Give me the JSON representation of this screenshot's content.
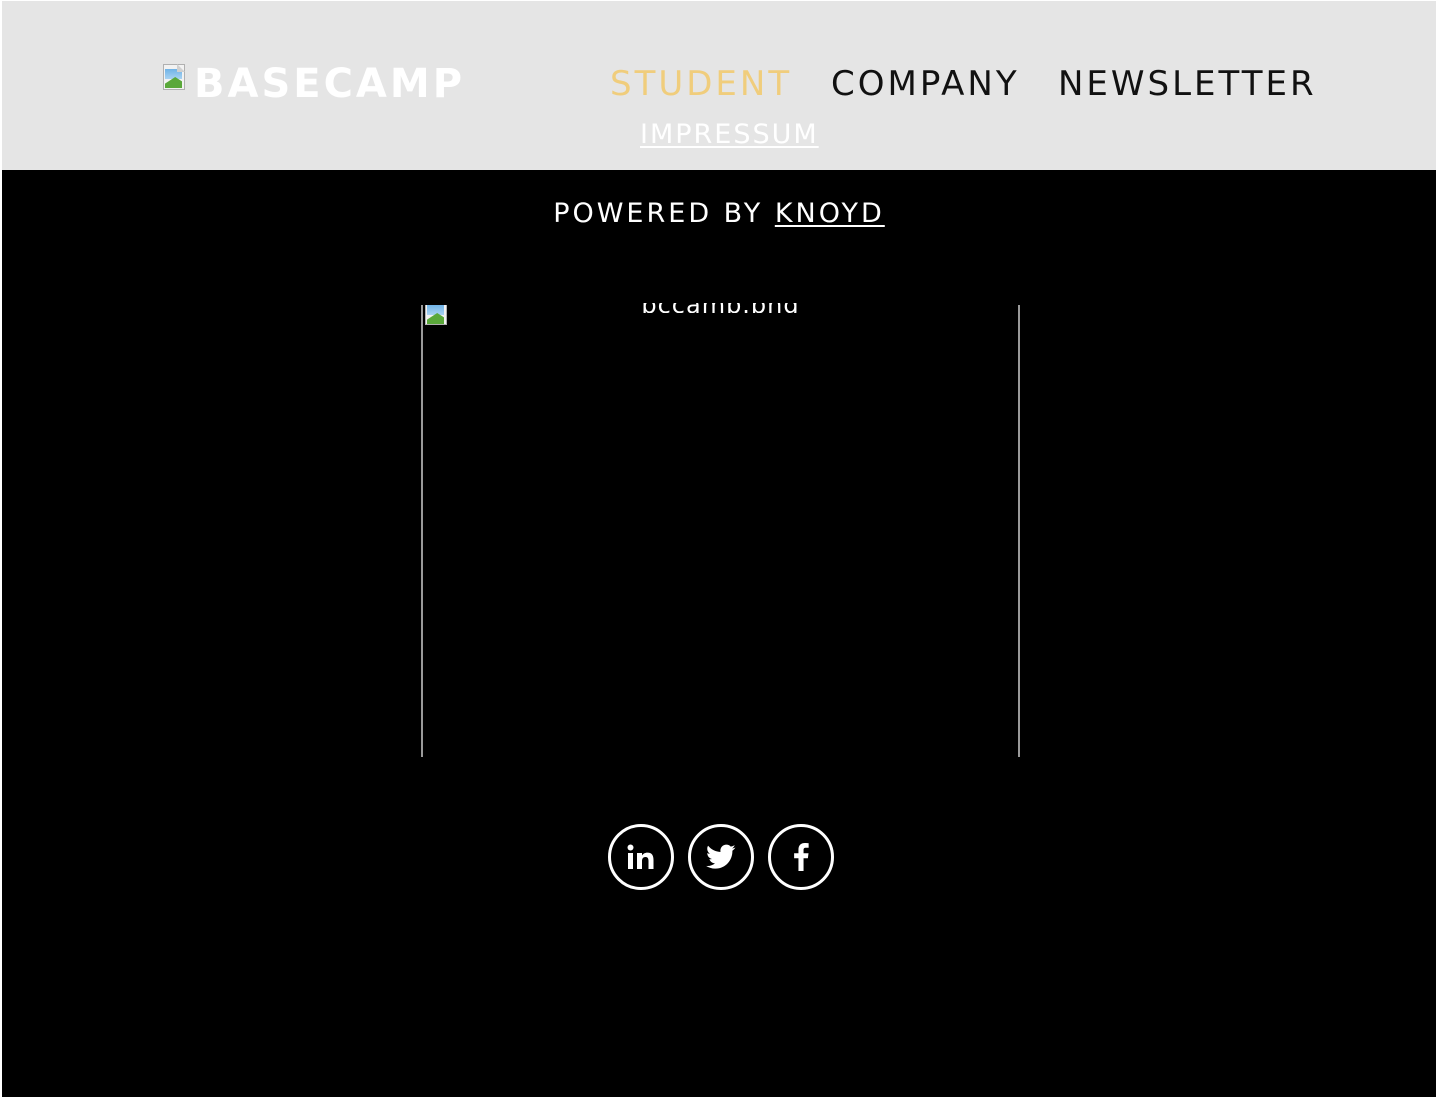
{
  "header": {
    "logo_alt": "BASECAMP",
    "nav": {
      "student": "STUDENT",
      "company": "COMPANY",
      "newsletter": "NEWSLETTER"
    },
    "impressum": "IMPRESSUM"
  },
  "footer": {
    "powered_prefix": "POWERED BY ",
    "powered_link": "KNOYD",
    "image_alt": "bccamp.png"
  },
  "socials": [
    {
      "name": "linkedin",
      "icon": "linkedin-icon"
    },
    {
      "name": "twitter",
      "icon": "twitter-icon"
    },
    {
      "name": "facebook",
      "icon": "facebook-icon"
    }
  ],
  "colors": {
    "header_bg": "#e5e5e5",
    "page_bg": "#000000",
    "active_nav": "#f0cd7c",
    "nav_text": "#111111",
    "footer_text": "#ffffff"
  }
}
